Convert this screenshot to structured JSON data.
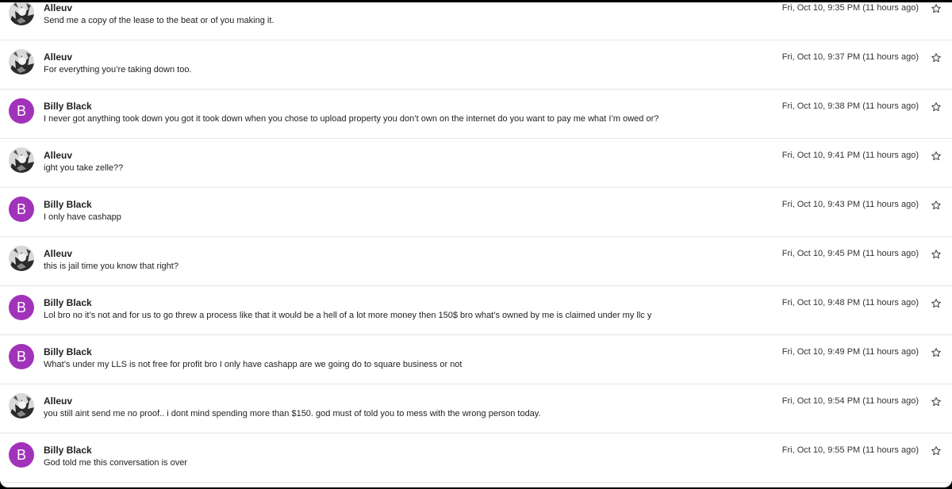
{
  "colors": {
    "letter_avatar_bg": "#a033b9",
    "divider": "#e6e6e6"
  },
  "messages": [
    {
      "sender": "Alleuv",
      "avatar": {
        "type": "photo",
        "icon": "user-photo"
      },
      "body": "Send me a copy of the lease to the beat or of you making it.",
      "time": "Fri, Oct 10, 9:35 PM (11 hours ago)",
      "starred": false
    },
    {
      "sender": "Alleuv",
      "avatar": {
        "type": "photo",
        "icon": "user-photo"
      },
      "body": "For everything you’re taking down too.",
      "time": "Fri, Oct 10, 9:37 PM (11 hours ago)",
      "starred": false
    },
    {
      "sender": "Billy Black",
      "avatar": {
        "type": "letter",
        "letter": "B"
      },
      "body": "I never got anything took down you got it took down when you chose to upload property you don’t own on the internet do you want to pay me what I’m owed or?",
      "time": "Fri, Oct 10, 9:38 PM (11 hours ago)",
      "starred": false
    },
    {
      "sender": "Alleuv",
      "avatar": {
        "type": "photo",
        "icon": "user-photo"
      },
      "body": "ight you take zelle??",
      "time": "Fri, Oct 10, 9:41 PM (11 hours ago)",
      "starred": false
    },
    {
      "sender": "Billy Black",
      "avatar": {
        "type": "letter",
        "letter": "B"
      },
      "body": "I only have cashapp",
      "time": "Fri, Oct 10, 9:43 PM (11 hours ago)",
      "starred": false
    },
    {
      "sender": "Alleuv",
      "avatar": {
        "type": "photo",
        "icon": "user-photo"
      },
      "body": "this is jail time you know that right?",
      "time": "Fri, Oct 10, 9:45 PM (11 hours ago)",
      "starred": false
    },
    {
      "sender": "Billy Black",
      "avatar": {
        "type": "letter",
        "letter": "B"
      },
      "body": "Lol bro no it’s not and for us to go threw a process like that it would be a hell of a lot more money then 150$ bro what’s owned by me is claimed under my llc y",
      "time": "Fri, Oct 10, 9:48 PM (11 hours ago)",
      "starred": false
    },
    {
      "sender": "Billy Black",
      "avatar": {
        "type": "letter",
        "letter": "B"
      },
      "body": "What’s under my LLS is not free for profit bro I only have cashapp are we going do to square business or not",
      "time": "Fri, Oct 10, 9:49 PM (11 hours ago)",
      "starred": false
    },
    {
      "sender": "Alleuv",
      "avatar": {
        "type": "photo",
        "icon": "user-photo"
      },
      "body": "you still aint send me no proof.. i dont mind spending more than $150. god must of told you to mess with the wrong person today.",
      "time": "Fri, Oct 10, 9:54 PM (11 hours ago)",
      "starred": false
    },
    {
      "sender": "Billy Black",
      "avatar": {
        "type": "letter",
        "letter": "B"
      },
      "body": "God told me this conversation is over",
      "time": "Fri, Oct 10, 9:55 PM (11 hours ago)",
      "starred": false
    }
  ]
}
